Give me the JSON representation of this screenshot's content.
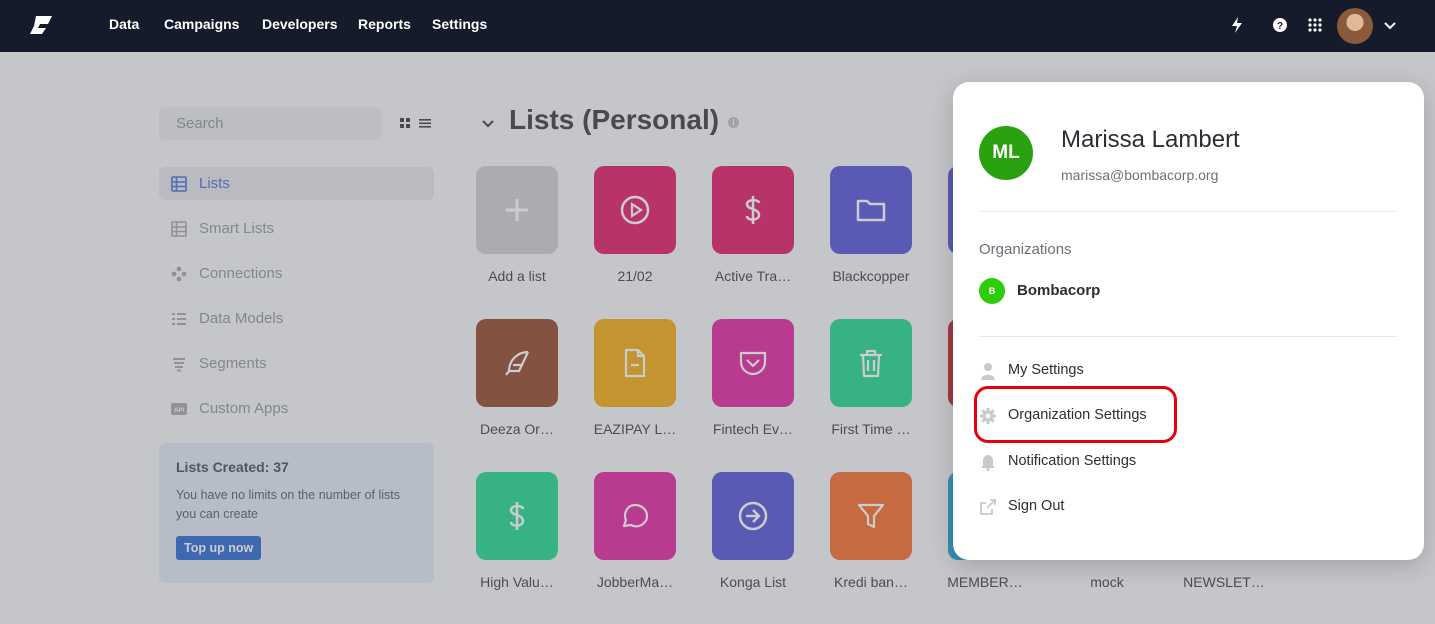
{
  "nav": {
    "items": [
      "Data",
      "Campaigns",
      "Developers",
      "Reports",
      "Settings"
    ],
    "icons": [
      "lightning-icon",
      "help-icon",
      "apps-grid-icon"
    ]
  },
  "sidebar": {
    "search_placeholder": "Search",
    "items": [
      {
        "label": "Lists",
        "icon": "table-icon",
        "active": true
      },
      {
        "label": "Smart Lists",
        "icon": "smart-list-icon",
        "active": false
      },
      {
        "label": "Connections",
        "icon": "connections-icon",
        "active": false
      },
      {
        "label": "Data Models",
        "icon": "data-models-icon",
        "active": false
      },
      {
        "label": "Segments",
        "icon": "segments-icon",
        "active": false
      },
      {
        "label": "Custom Apps",
        "icon": "api-icon",
        "active": false
      }
    ],
    "promo": {
      "title": "Lists Created: 37",
      "text": "You have no limits on the number of lists you can create",
      "button": "Top up now"
    }
  },
  "main": {
    "section_title": "Lists (Personal)",
    "info_glyph": "i",
    "tiles": [
      {
        "label": "Add a list",
        "color": "#c9cbd0",
        "icon": "plus-icon"
      },
      {
        "label": "21/02",
        "color": "#e0095f",
        "icon": "play-icon"
      },
      {
        "label": "Active Tra…",
        "color": "#e0095f",
        "icon": "dollar-icon"
      },
      {
        "label": "Blackcopper",
        "color": "#4547d4",
        "icon": "folder-icon"
      },
      {
        "label": "Deeza Or…",
        "color": "#8b3a1c",
        "icon": "feather-icon"
      },
      {
        "label": "EAZIPAY L…",
        "color": "#f0a500",
        "icon": "document-icon"
      },
      {
        "label": "Fintech Ev…",
        "color": "#e0169a",
        "icon": "pocket-icon"
      },
      {
        "label": "First Time …",
        "color": "#0fd58a",
        "icon": "trash-icon"
      },
      {
        "label": "High Valu…",
        "color": "#0fd58a",
        "icon": "dollar-icon"
      },
      {
        "label": "JobberMa…",
        "color": "#e0169a",
        "icon": "chat-icon"
      },
      {
        "label": "Konga List",
        "color": "#4547d4",
        "icon": "arrow-right-circle-icon"
      },
      {
        "label": "Kredi ban…",
        "color": "#f5611d",
        "icon": "filter-icon"
      },
      {
        "label": "MEMBER…",
        "color": "#0b9fd6",
        "icon": "generic-icon"
      },
      {
        "label": "mock",
        "color": "",
        "icon": ""
      },
      {
        "label": "NEWSLET…",
        "color": "",
        "icon": ""
      }
    ]
  },
  "profile_menu": {
    "initials": "ML",
    "name": "Marissa Lambert",
    "email": "marissa@bombacorp.org",
    "organizations_heading": "Organizations",
    "org_initial": "B",
    "org_name": "Bombacorp",
    "items": [
      {
        "label": "My Settings",
        "icon": "user-icon"
      },
      {
        "label": "Organization Settings",
        "icon": "gear-icon"
      },
      {
        "label": "Notification Settings",
        "icon": "bell-icon"
      },
      {
        "label": "Sign Out",
        "icon": "external-link-icon"
      }
    ],
    "highlight_color": "#e3000f"
  }
}
